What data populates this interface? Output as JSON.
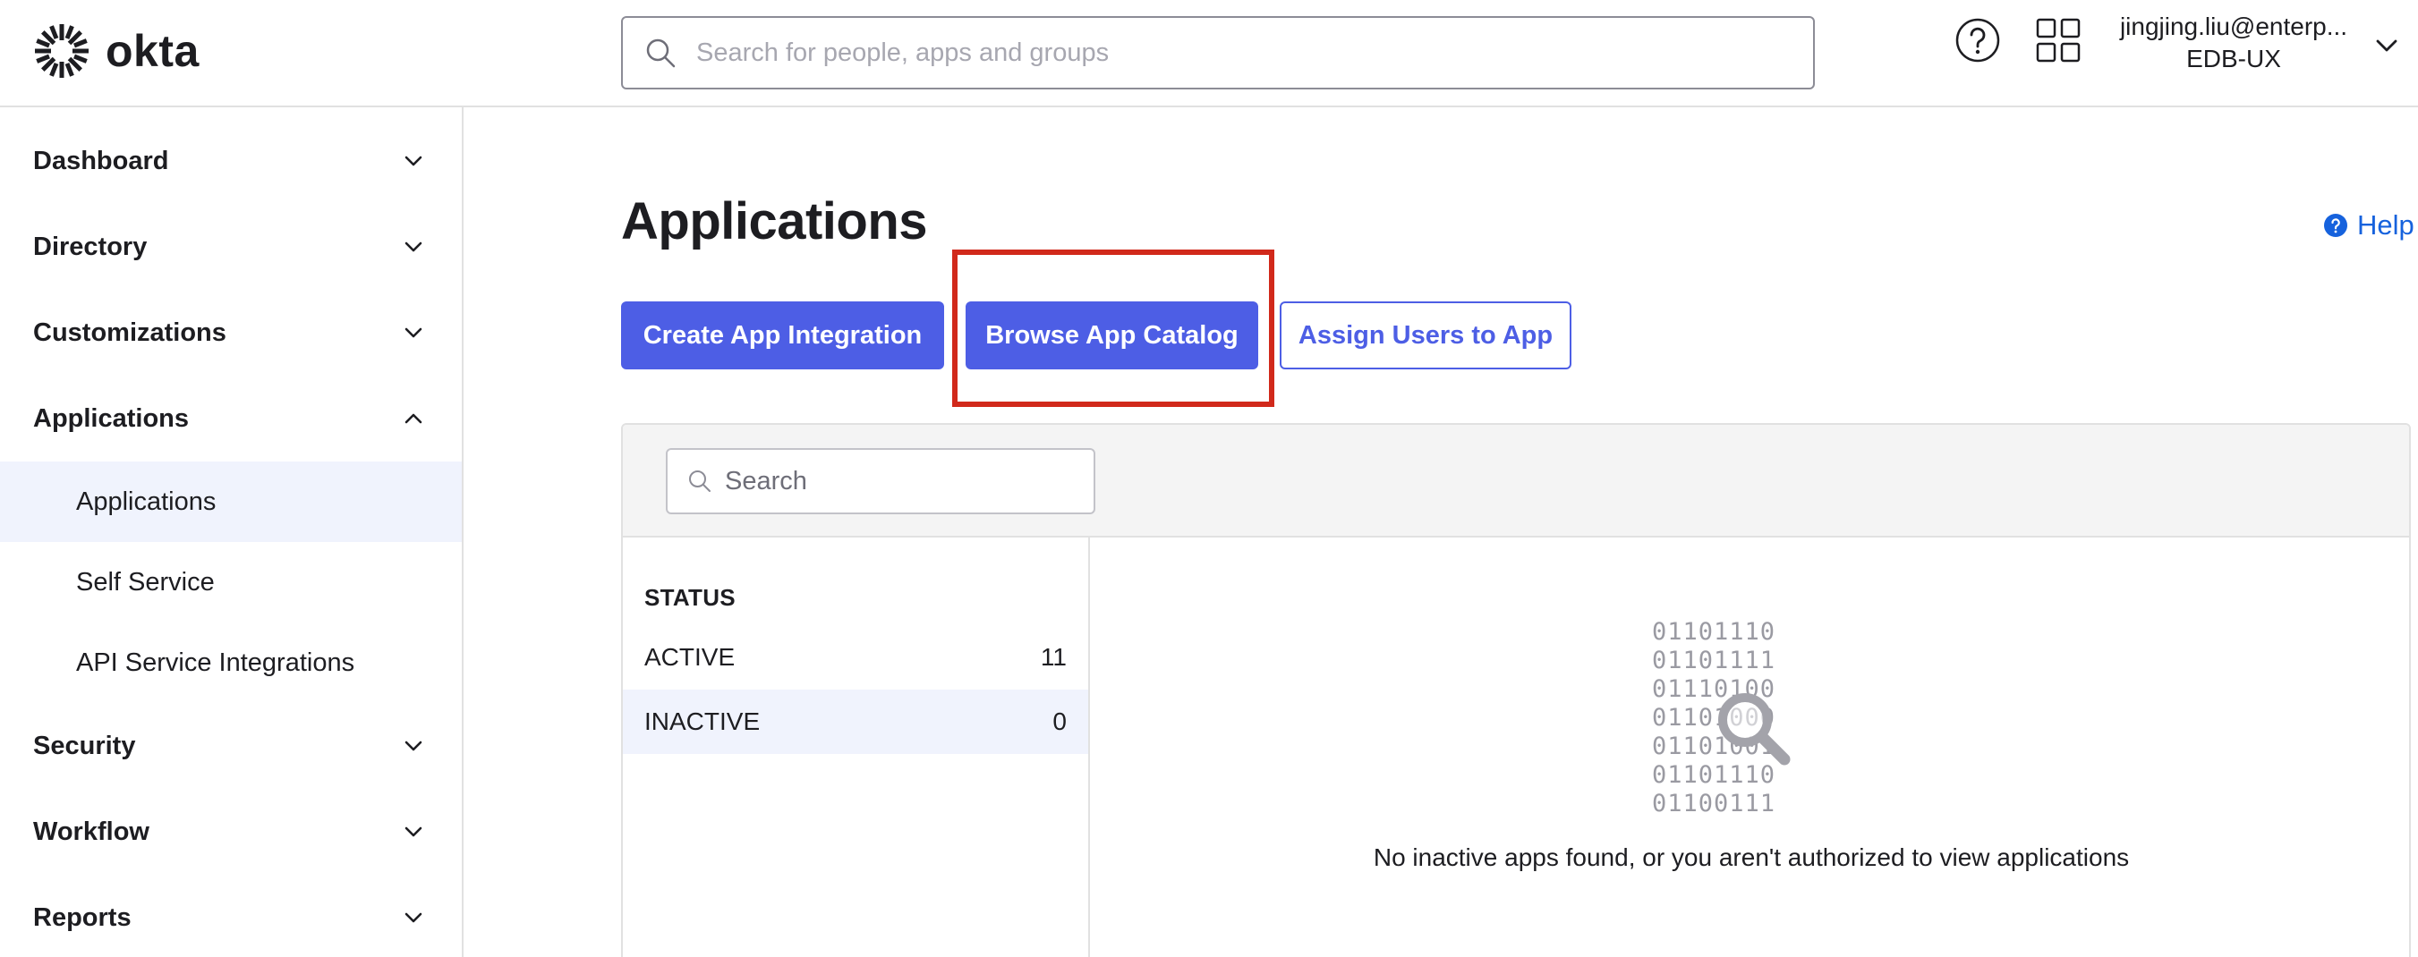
{
  "header": {
    "logo_text": "okta",
    "search_placeholder": "Search for people, apps and groups",
    "user_email": "jingjing.liu@enterp...",
    "user_org": "EDB-UX"
  },
  "sidebar": {
    "sections": [
      {
        "label": "Dashboard",
        "expanded": false
      },
      {
        "label": "Directory",
        "expanded": false
      },
      {
        "label": "Customizations",
        "expanded": false
      },
      {
        "label": "Applications",
        "expanded": true
      },
      {
        "label": "Security",
        "expanded": false
      },
      {
        "label": "Workflow",
        "expanded": false
      },
      {
        "label": "Reports",
        "expanded": false
      }
    ],
    "applications_items": [
      {
        "label": "Applications",
        "active": true
      },
      {
        "label": "Self Service",
        "active": false
      },
      {
        "label": "API Service Integrations",
        "active": false
      }
    ]
  },
  "main": {
    "title": "Applications",
    "help_label": "Help",
    "buttons": {
      "create": "Create App Integration",
      "browse": "Browse App Catalog",
      "assign": "Assign Users to App"
    },
    "filter_search_placeholder": "Search",
    "status": {
      "heading": "STATUS",
      "rows": [
        {
          "label": "ACTIVE",
          "count": "11",
          "selected": false
        },
        {
          "label": "INACTIVE",
          "count": "0",
          "selected": true
        }
      ]
    },
    "empty_state": {
      "binary_lines": [
        "01101110",
        "01101111",
        "01110100",
        "01101000",
        "01101001",
        "01101110",
        "01100111"
      ],
      "message": "No inactive apps found, or you aren't authorized to view applications"
    }
  },
  "colors": {
    "primary": "#4d5ee5",
    "highlight": "#d1291b",
    "help_link": "#1662dd",
    "selected_bg": "#f0f3fd"
  }
}
